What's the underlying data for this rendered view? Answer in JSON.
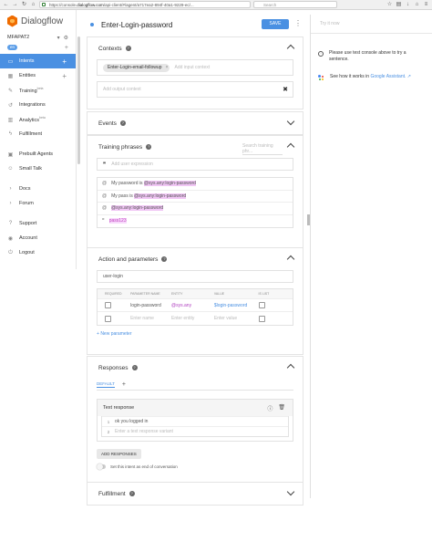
{
  "browser": {
    "url_prefix": "https://console.",
    "url_domain": "dialogflow.com",
    "url_rest": "/api-client/#/agent/a717ea2-894f-40a1-9229-ec/...",
    "search_placeholder": "Search",
    "nav_icons": [
      "back-icon",
      "forward-icon",
      "reload-icon",
      "home-icon"
    ],
    "toolbar_icons": [
      "star-icon",
      "bookmark-icon",
      "download-icon",
      "home-icon",
      "menu-icon"
    ]
  },
  "sidebar": {
    "logo_text": "Dialogflow",
    "agent_name": "MFAPAT2",
    "language": "en",
    "items": [
      {
        "label": "Intents",
        "icon": "chat-icon",
        "active": true,
        "add": true
      },
      {
        "label": "Entities",
        "icon": "entity-icon",
        "add": true
      },
      {
        "label": "Training",
        "icon": "training-icon",
        "beta": "beta"
      },
      {
        "label": "Integrations",
        "icon": "integrations-icon"
      },
      {
        "label": "Analytics",
        "icon": "analytics-icon",
        "beta": "beta"
      },
      {
        "label": "Fulfillment",
        "icon": "fulfillment-icon"
      },
      {
        "label": "Prebuilt Agents",
        "icon": "prebuilt-icon"
      },
      {
        "label": "Small Talk",
        "icon": "smalltalk-icon"
      },
      {
        "label": "Docs",
        "icon": "chevron-right-icon"
      },
      {
        "label": "Forum",
        "icon": "chevron-right-icon"
      },
      {
        "label": "Support",
        "icon": "help-icon"
      },
      {
        "label": "Account",
        "icon": "account-icon"
      },
      {
        "label": "Logout",
        "icon": "logout-icon"
      }
    ]
  },
  "header": {
    "title": "Enter-Login-password",
    "save_label": "SAVE"
  },
  "contexts": {
    "title": "Contexts",
    "input_chip": "Enter-Login-email-followup",
    "input_placeholder": "Add input context",
    "output_placeholder": "Add output context"
  },
  "events": {
    "title": "Events"
  },
  "training": {
    "title": "Training phrases",
    "search_placeholder": "Search training phr...",
    "add_placeholder": "Add user expression",
    "phrases": [
      {
        "pre": "My password is ",
        "hl": "@sys.any:login-password",
        "post": ""
      },
      {
        "pre": "My pass is ",
        "hl": "@sys.any:login-password",
        "post": ""
      },
      {
        "pre": "",
        "hl": "@sys.any:login-password",
        "post": ""
      },
      {
        "pre": "",
        "hl": "pass123",
        "post": ""
      }
    ]
  },
  "actions": {
    "title": "Action and parameters",
    "action_value": "user-login",
    "headers": [
      "REQUIRED",
      "PARAMETER NAME",
      "ENTITY",
      "VALUE",
      "IS LIST"
    ],
    "rows": [
      {
        "name": "login-password",
        "entity": "@sys.any",
        "value": "$login-password"
      },
      {
        "name": "Enter name",
        "entity": "Enter entity",
        "value": "Enter value"
      }
    ],
    "new_parameter": "New parameter"
  },
  "responses": {
    "title": "Responses",
    "tab_default": "DEFAULT",
    "box_title": "Text response",
    "lines": [
      {
        "n": "1",
        "text": "ok you logged in"
      },
      {
        "n": "2",
        "text": "Enter a text response variant"
      }
    ],
    "add_button": "ADD RESPONSES",
    "end_conversation": "Set this intent as end of conversation"
  },
  "fulfillment": {
    "title": "Fulfillment"
  },
  "right_panel": {
    "try_it": "Try it now",
    "hint": "Please use test console above to try a sentence.",
    "ga_text": "See how it works in ",
    "ga_link": "Google Assistant."
  },
  "colors": {
    "accent": "#4a90e2",
    "brand": "#ef6c00",
    "entity_highlight": "#f1c6f5"
  }
}
